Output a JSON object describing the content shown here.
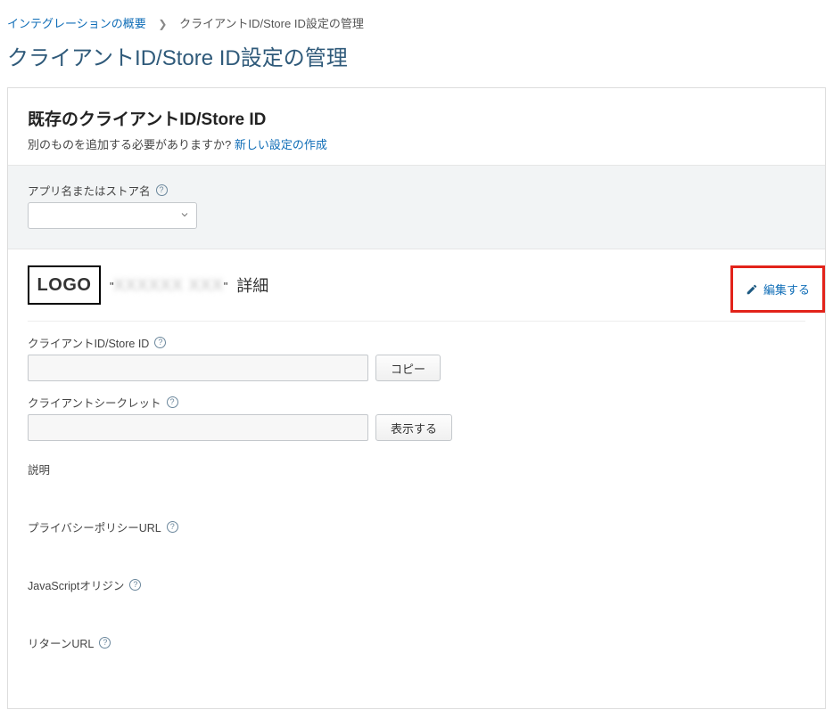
{
  "breadcrumb": {
    "parent": "インテグレーションの概要",
    "current": "クライアントID/Store ID設定の管理"
  },
  "page_title": "クライアントID/Store ID設定の管理",
  "panel": {
    "heading": "既存のクライアントID/Store ID",
    "subtext_prefix": "別のものを追加する必要がありますか? ",
    "subtext_link": "新しい設定の作成"
  },
  "select_section": {
    "label": "アプリ名またはストア名",
    "selected": " "
  },
  "detail": {
    "logo_text": "LOGO",
    "app_name_masked": "XXXXXX XXX",
    "title_suffix": "詳細",
    "edit_label": "編集する",
    "client_id": {
      "label": "クライアントID/Store ID",
      "button": "コピー"
    },
    "client_secret": {
      "label": "クライアントシークレット",
      "button": "表示する"
    },
    "description_label": "説明",
    "privacy_label": "プライバシーポリシーURL",
    "javascript_label": "JavaScriptオリジン",
    "return_label": "リターンURL"
  }
}
